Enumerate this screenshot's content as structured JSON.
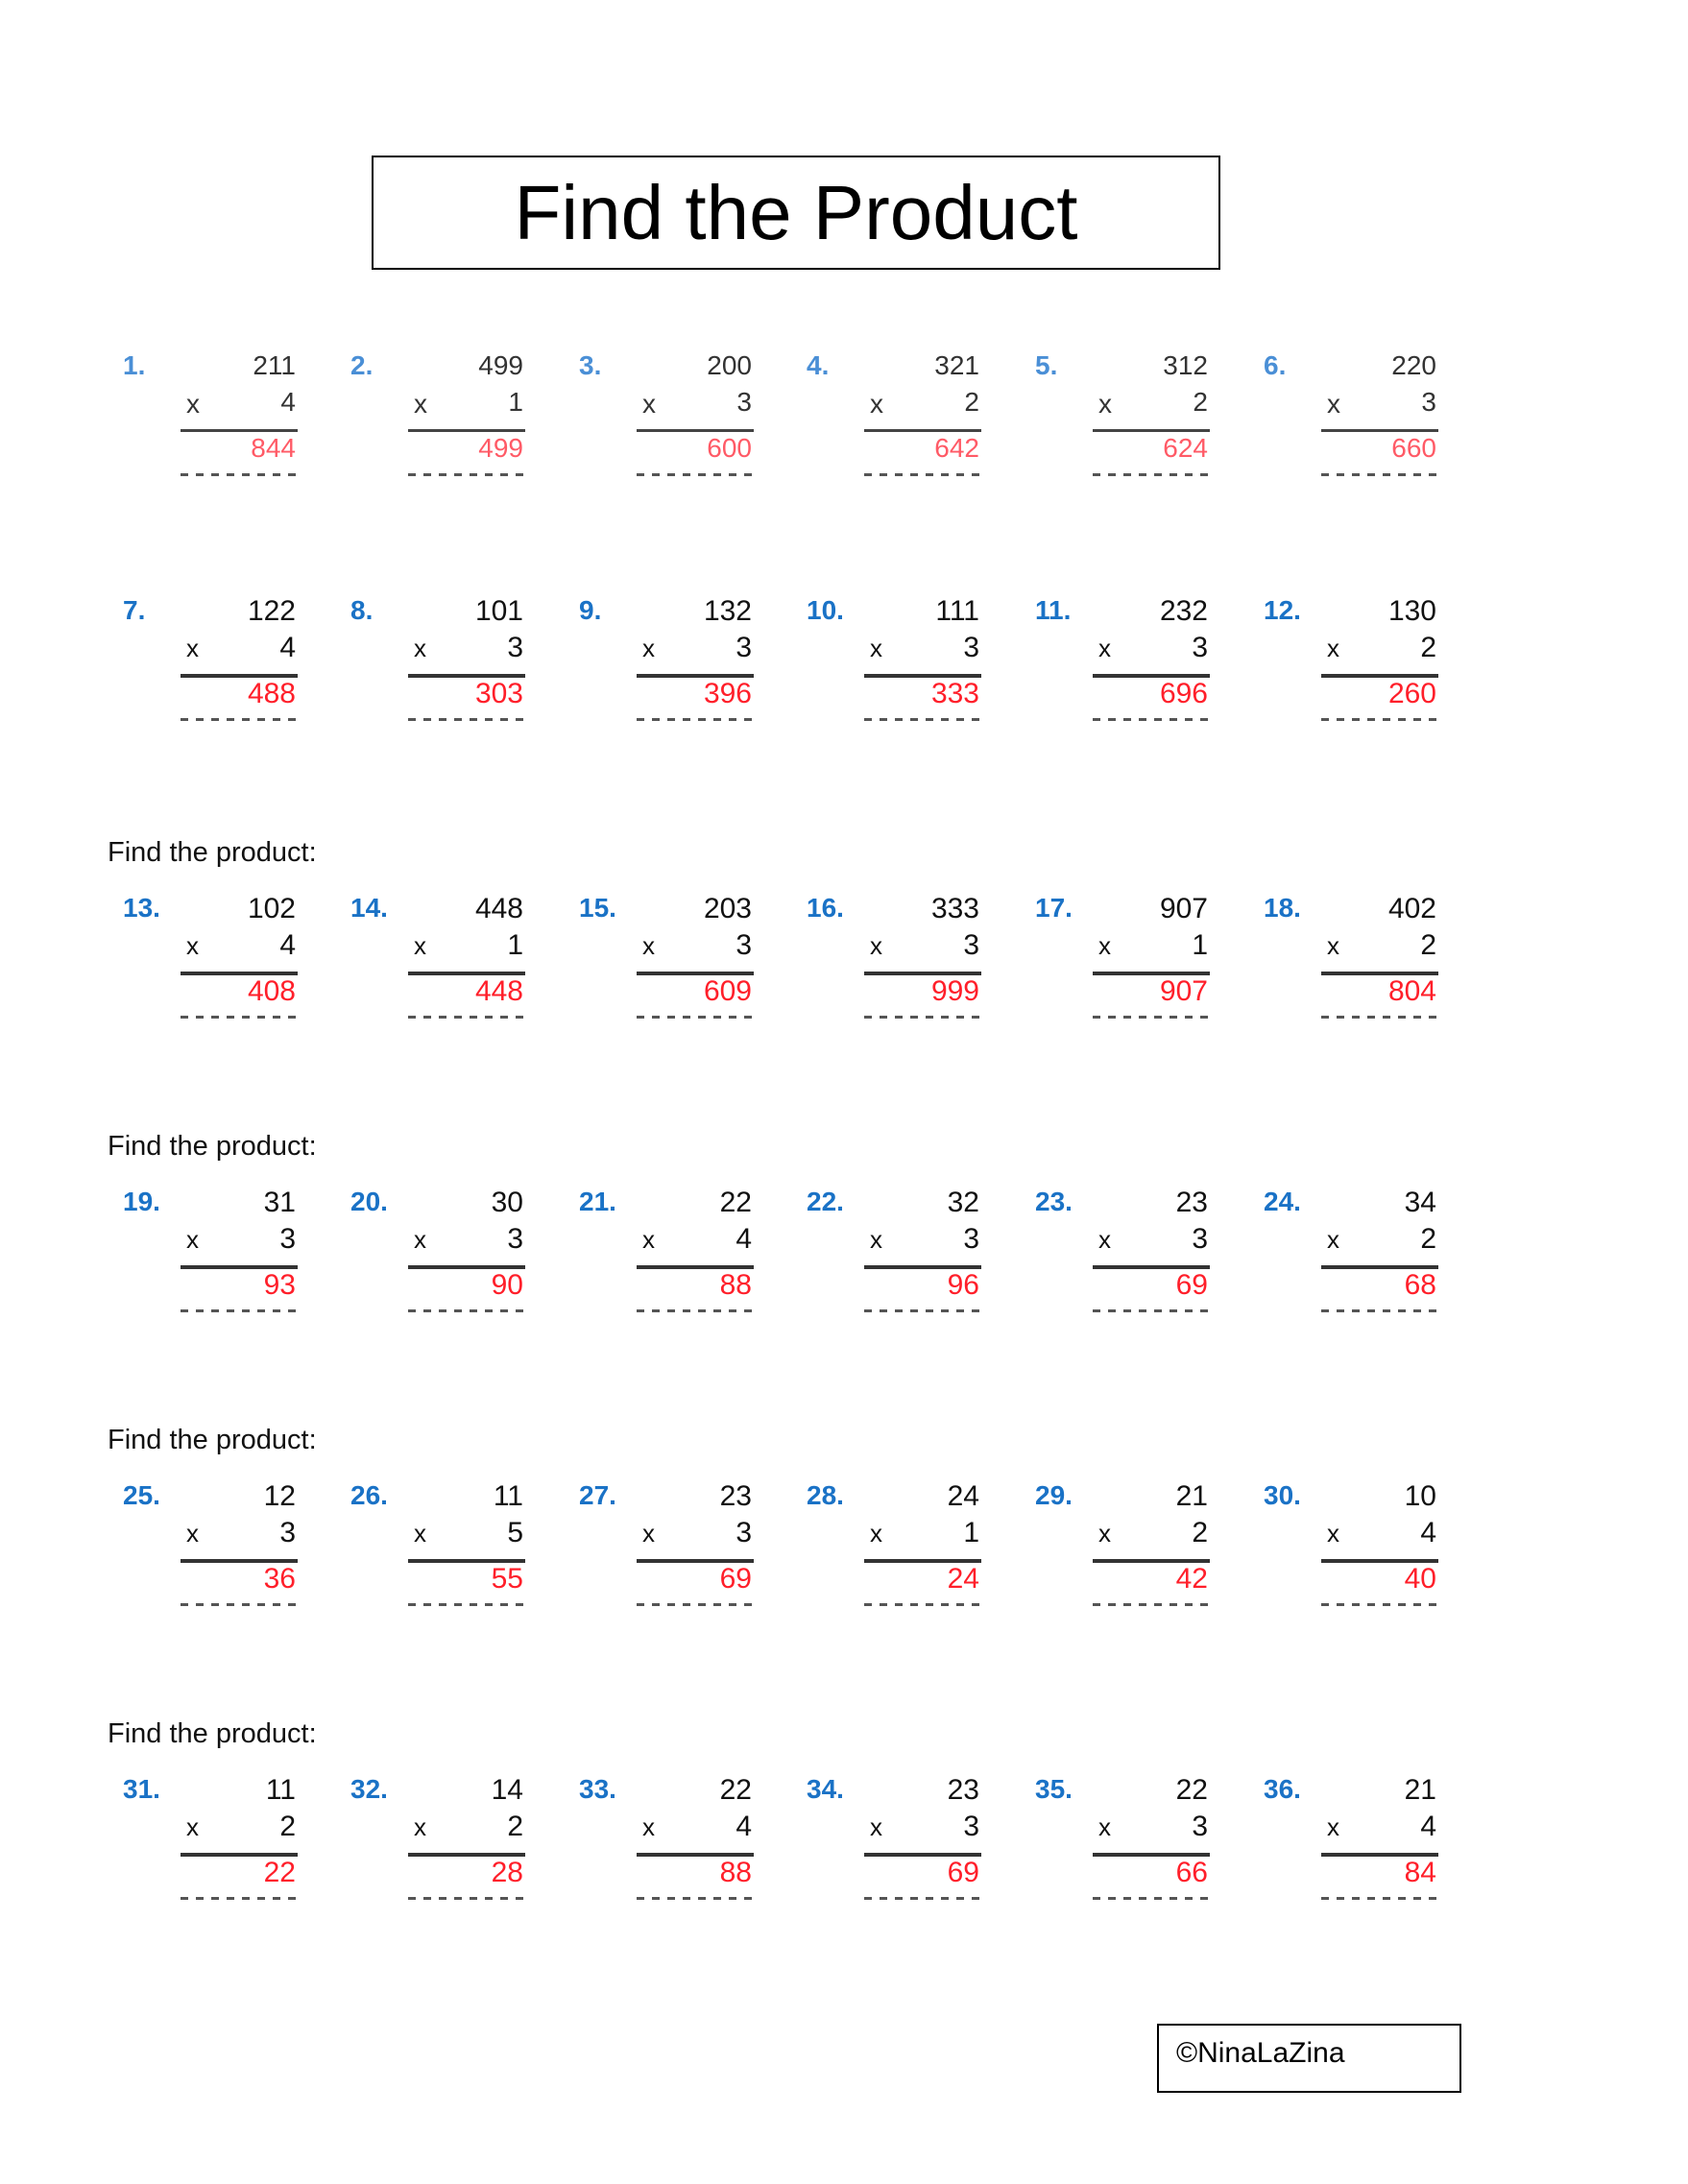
{
  "title": "Find the Product",
  "section_label": "Find the product:",
  "copyright": "©NinaLaZina",
  "colors": {
    "problem_number": "#1a72c6",
    "answer": "#ff1f2a",
    "text": "#111111"
  },
  "rows": [
    {
      "label": null,
      "problems": [
        {
          "num": "1.",
          "top": "211",
          "mult": "4",
          "answer": "844"
        },
        {
          "num": "2.",
          "top": "499",
          "mult": "1",
          "answer": "499"
        },
        {
          "num": "3.",
          "top": "200",
          "mult": "3",
          "answer": "600"
        },
        {
          "num": "4.",
          "top": "321",
          "mult": "2",
          "answer": "642"
        },
        {
          "num": "5.",
          "top": "312",
          "mult": "2",
          "answer": "624"
        },
        {
          "num": "6.",
          "top": "220",
          "mult": "3",
          "answer": "660"
        }
      ]
    },
    {
      "label": null,
      "problems": [
        {
          "num": "7.",
          "top": "122",
          "mult": "4",
          "answer": "488"
        },
        {
          "num": "8.",
          "top": "101",
          "mult": "3",
          "answer": "303"
        },
        {
          "num": "9.",
          "top": "132",
          "mult": "3",
          "answer": "396"
        },
        {
          "num": "10.",
          "top": "111",
          "mult": "3",
          "answer": "333"
        },
        {
          "num": "11.",
          "top": "232",
          "mult": "3",
          "answer": "696"
        },
        {
          "num": "12.",
          "top": "130",
          "mult": "2",
          "answer": "260"
        }
      ]
    },
    {
      "label": "Find the product:",
      "problems": [
        {
          "num": "13.",
          "top": "102",
          "mult": "4",
          "answer": "408"
        },
        {
          "num": "14.",
          "top": "448",
          "mult": "1",
          "answer": "448"
        },
        {
          "num": "15.",
          "top": "203",
          "mult": "3",
          "answer": "609"
        },
        {
          "num": "16.",
          "top": "333",
          "mult": "3",
          "answer": "999"
        },
        {
          "num": "17.",
          "top": "907",
          "mult": "1",
          "answer": "907"
        },
        {
          "num": "18.",
          "top": "402",
          "mult": "2",
          "answer": "804"
        }
      ]
    },
    {
      "label": "Find the product:",
      "problems": [
        {
          "num": "19.",
          "top": "31",
          "mult": "3",
          "answer": "93"
        },
        {
          "num": "20.",
          "top": "30",
          "mult": "3",
          "answer": "90"
        },
        {
          "num": "21.",
          "top": "22",
          "mult": "4",
          "answer": "88"
        },
        {
          "num": "22.",
          "top": "32",
          "mult": "3",
          "answer": "96"
        },
        {
          "num": "23.",
          "top": "23",
          "mult": "3",
          "answer": "69"
        },
        {
          "num": "24.",
          "top": "34",
          "mult": "2",
          "answer": "68"
        }
      ]
    },
    {
      "label": "Find the product:",
      "problems": [
        {
          "num": "25.",
          "top": "12",
          "mult": "3",
          "answer": "36"
        },
        {
          "num": "26.",
          "top": "11",
          "mult": "5",
          "answer": "55"
        },
        {
          "num": "27.",
          "top": "23",
          "mult": "3",
          "answer": "69"
        },
        {
          "num": "28.",
          "top": "24",
          "mult": "1",
          "answer": "24"
        },
        {
          "num": "29.",
          "top": "21",
          "mult": "2",
          "answer": "42"
        },
        {
          "num": "30.",
          "top": "10",
          "mult": "4",
          "answer": "40"
        }
      ]
    },
    {
      "label": "Find the product:",
      "problems": [
        {
          "num": "31.",
          "top": "11",
          "mult": "2",
          "answer": "22"
        },
        {
          "num": "32.",
          "top": "14",
          "mult": "2",
          "answer": "28"
        },
        {
          "num": "33.",
          "top": "22",
          "mult": "4",
          "answer": "88"
        },
        {
          "num": "34.",
          "top": "23",
          "mult": "3",
          "answer": "69"
        },
        {
          "num": "35.",
          "top": "22",
          "mult": "3",
          "answer": "66"
        },
        {
          "num": "36.",
          "top": "21",
          "mult": "4",
          "answer": "84"
        }
      ]
    }
  ],
  "times_symbol": "x"
}
